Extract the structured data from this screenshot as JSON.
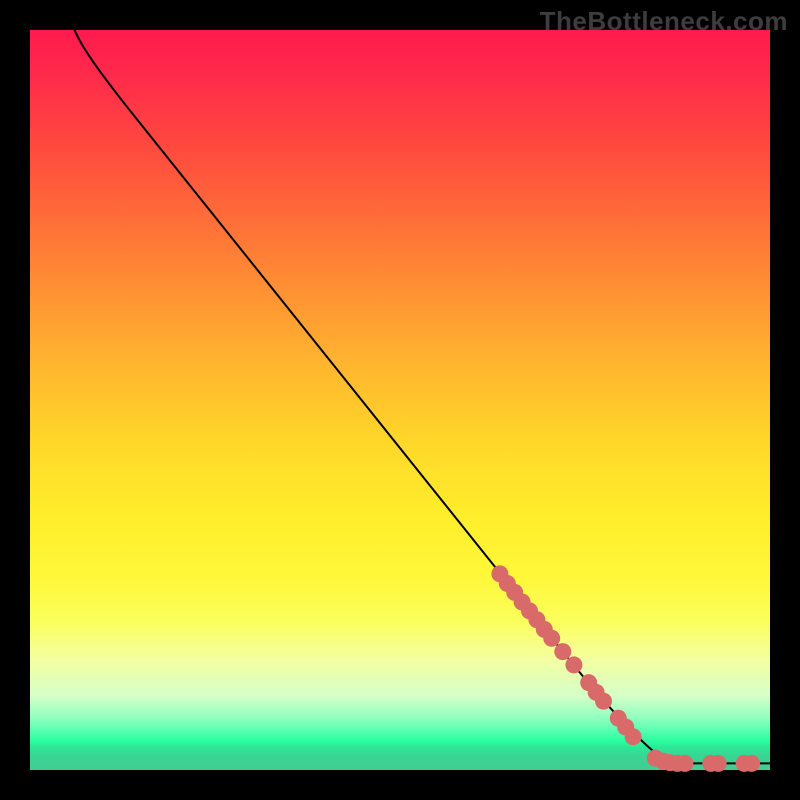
{
  "watermark": "TheBottleneck.com",
  "chart_data": {
    "type": "line",
    "title": "",
    "xlabel": "",
    "ylabel": "",
    "xlim": [
      0,
      100
    ],
    "ylim": [
      0,
      100
    ],
    "curve": [
      {
        "x": 6,
        "y": 100
      },
      {
        "x": 7,
        "y": 98
      },
      {
        "x": 9,
        "y": 95
      },
      {
        "x": 12,
        "y": 91
      },
      {
        "x": 16,
        "y": 86
      },
      {
        "x": 24,
        "y": 76
      },
      {
        "x": 34,
        "y": 63.5
      },
      {
        "x": 46,
        "y": 48.5
      },
      {
        "x": 58,
        "y": 33.5
      },
      {
        "x": 68,
        "y": 21
      },
      {
        "x": 76,
        "y": 11
      },
      {
        "x": 82,
        "y": 4.5
      },
      {
        "x": 85.5,
        "y": 1.4
      },
      {
        "x": 87,
        "y": 0.9
      },
      {
        "x": 90,
        "y": 0.9
      },
      {
        "x": 94,
        "y": 0.9
      },
      {
        "x": 98,
        "y": 0.9
      },
      {
        "x": 100,
        "y": 0.9
      }
    ],
    "points": [
      {
        "x": 63.5,
        "y": 26.5
      },
      {
        "x": 64.5,
        "y": 25.2
      },
      {
        "x": 65.5,
        "y": 24.0
      },
      {
        "x": 66.5,
        "y": 22.7
      },
      {
        "x": 67.5,
        "y": 21.5
      },
      {
        "x": 68.5,
        "y": 20.3
      },
      {
        "x": 69.5,
        "y": 19.0
      },
      {
        "x": 70.5,
        "y": 17.8
      },
      {
        "x": 72.0,
        "y": 16.0
      },
      {
        "x": 73.5,
        "y": 14.2
      },
      {
        "x": 75.5,
        "y": 11.8
      },
      {
        "x": 76.5,
        "y": 10.5
      },
      {
        "x": 77.5,
        "y": 9.3
      },
      {
        "x": 79.5,
        "y": 7.0
      },
      {
        "x": 80.5,
        "y": 5.8
      },
      {
        "x": 81.5,
        "y": 4.5
      },
      {
        "x": 84.5,
        "y": 1.6
      },
      {
        "x": 85.5,
        "y": 1.2
      },
      {
        "x": 86.5,
        "y": 1.0
      },
      {
        "x": 87.5,
        "y": 0.9
      },
      {
        "x": 88.5,
        "y": 0.9
      },
      {
        "x": 92.0,
        "y": 0.9
      },
      {
        "x": 93.0,
        "y": 0.9
      },
      {
        "x": 96.5,
        "y": 0.9
      },
      {
        "x": 97.5,
        "y": 0.9
      }
    ],
    "point_color": "#d86a6a"
  }
}
